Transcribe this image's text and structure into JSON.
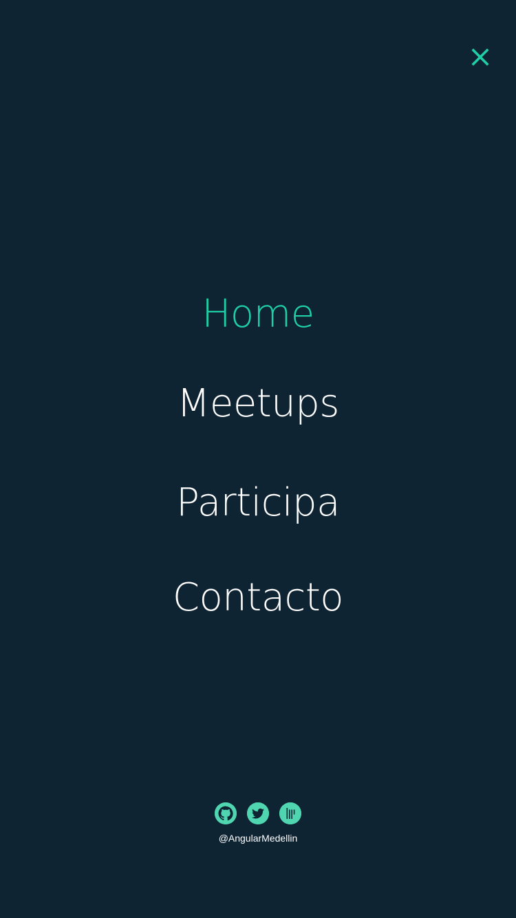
{
  "header": {
    "close_icon": "close-x-icon",
    "accent_color": "#1fcfa6"
  },
  "nav": {
    "items": [
      {
        "label": "Home",
        "active": true
      },
      {
        "label": "Meetups",
        "active": false
      },
      {
        "label": "Participa",
        "active": false
      },
      {
        "label": "Contacto",
        "active": false
      }
    ]
  },
  "footer": {
    "social": [
      {
        "icon": "github-icon"
      },
      {
        "icon": "twitter-icon"
      },
      {
        "icon": "gitter-icon"
      }
    ],
    "handle": "@AngularMedellin",
    "icon_color": "#4fd6b0"
  },
  "colors": {
    "background": "#0f2433",
    "text": "#ffffff"
  }
}
